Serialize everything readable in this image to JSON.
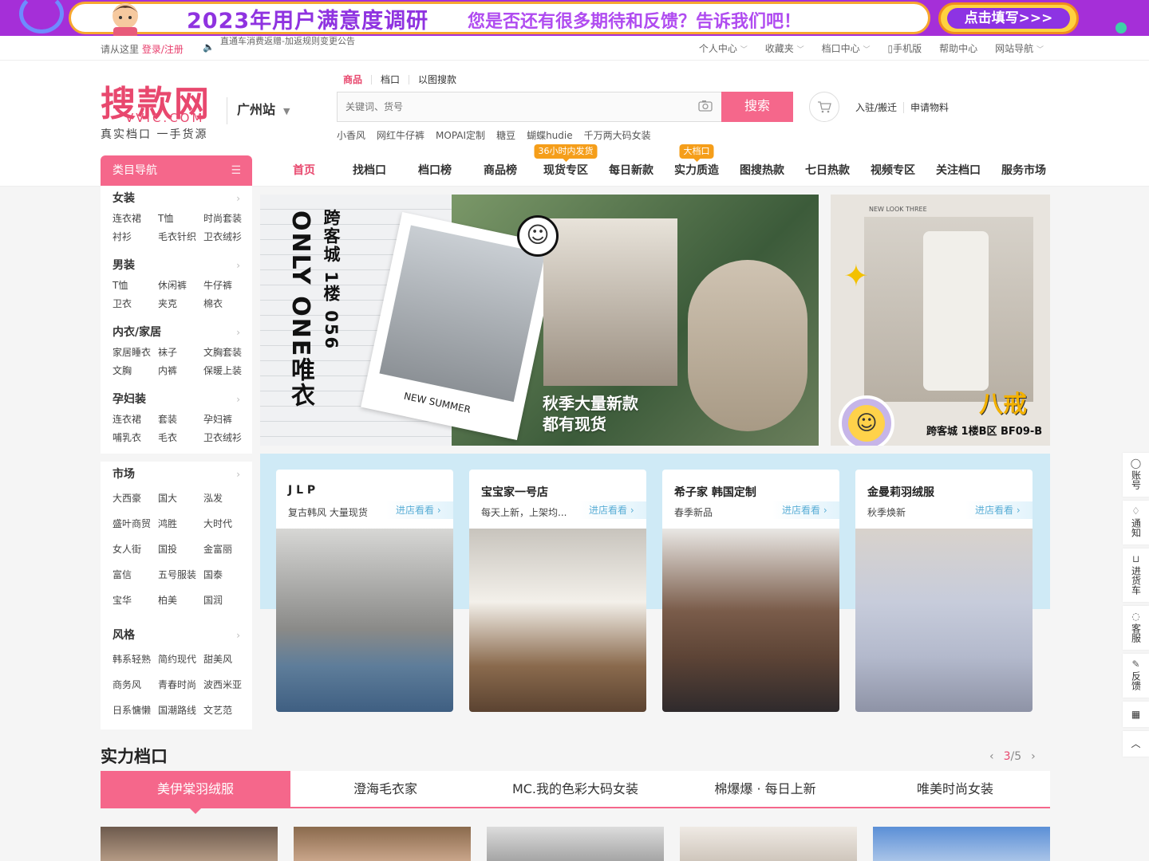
{
  "top_banner": {
    "title": "2023年用户满意度调研",
    "subtitle": "您是否还有很多期待和反馈？告诉我们吧！",
    "button": "点击填写>>>"
  },
  "top_nav": {
    "welcome": "请从这里",
    "login": "登录/注册",
    "notice": "直通车消费返赠-加返规则变更公告",
    "links": [
      "个人中心",
      "收藏夹",
      "档口中心",
      "手机版",
      "帮助中心",
      "网站导航"
    ]
  },
  "logo": {
    "cn": "搜款网",
    "en": "VVIC.COM",
    "slogan": "真实档口 一手货源"
  },
  "city": "广州站",
  "search": {
    "tabs": [
      "商品",
      "档口",
      "以图搜款"
    ],
    "placeholder": "关键词、货号",
    "button": "搜索",
    "hot_words": [
      "小香风",
      "网红牛仔裤",
      "MOPAI定制",
      "糖豆",
      "蝴蝶hudie",
      "千万两大码女装"
    ]
  },
  "header_links": [
    "入驻/搬迁",
    "申请物料"
  ],
  "category_nav_title": "类目导航",
  "main_nav": [
    {
      "label": "首页",
      "badge": ""
    },
    {
      "label": "找档口",
      "badge": ""
    },
    {
      "label": "档口榜",
      "badge": ""
    },
    {
      "label": "商品榜",
      "badge": ""
    },
    {
      "label": "现货专区",
      "badge": "36小时内发货"
    },
    {
      "label": "每日新款",
      "badge": ""
    },
    {
      "label": "实力质造",
      "badge": "大档口"
    },
    {
      "label": "图搜热款",
      "badge": ""
    },
    {
      "label": "七日热款",
      "badge": ""
    },
    {
      "label": "视频专区",
      "badge": ""
    },
    {
      "label": "关注档口",
      "badge": ""
    },
    {
      "label": "服务市场",
      "badge": ""
    }
  ],
  "sidebar": {
    "categories": [
      {
        "title": "女装",
        "items": [
          "连衣裙",
          "T恤",
          "时尚套装",
          "衬衫",
          "毛衣针织",
          "卫衣绒衫"
        ]
      },
      {
        "title": "男装",
        "items": [
          "T恤",
          "休闲裤",
          "牛仔裤",
          "卫衣",
          "夹克",
          "棉衣"
        ]
      },
      {
        "title": "内衣/家居",
        "items": [
          "家居睡衣",
          "袜子",
          "文胸套装",
          "文胸",
          "内裤",
          "保暖上装"
        ]
      },
      {
        "title": "孕妇装",
        "items": [
          "连衣裙",
          "套装",
          "孕妇裤",
          "哺乳衣",
          "毛衣",
          "卫衣绒衫"
        ]
      }
    ],
    "markets": {
      "title": "市场",
      "items": [
        "大西豪",
        "国大",
        "泓发",
        "盛叶商贸",
        "鸿胜",
        "大时代",
        "女人街",
        "国投",
        "金富丽",
        "富信",
        "五号服装",
        "国泰",
        "宝华",
        "柏美",
        "国润"
      ]
    },
    "styles": {
      "title": "风格",
      "items": [
        "韩系轻熟",
        "简约现代",
        "甜美风",
        "商务风",
        "青春时尚",
        "波西米亚",
        "日系慵懒",
        "国潮路线",
        "文艺范"
      ]
    }
  },
  "banner_main": {
    "vertical_text": "ONLY ONE唯衣",
    "location": "跨客城 1楼 056",
    "polaroid_caption": "NEW SUMMER",
    "caption_line1": "秋季大量新款",
    "caption_line2": "都有现货"
  },
  "banner_side": {
    "top_text": "NEW LOOK THREE",
    "brand": "八戒",
    "location": "跨客城 1楼B区 BF09-B"
  },
  "featured_shops": [
    {
      "name": "J L P",
      "desc": "复古韩风 大量现货",
      "go": "进店看看"
    },
    {
      "name": "宝宝家一号店",
      "desc": "每天上新，上架均...",
      "go": "进店看看"
    },
    {
      "name": "希子家 韩国定制",
      "desc": "春季新品",
      "go": "进店看看"
    },
    {
      "name": "金曼莉羽绒服",
      "desc": "秋季焕新",
      "go": "进店看看"
    }
  ],
  "strength_section": {
    "title": "实力档口",
    "page_current": "3",
    "page_total": "/5",
    "tabs": [
      "美伊棠羽绒服",
      "澄海毛衣家",
      "MC.我的色彩大码女装",
      "棉爆爆 · 每日上新",
      "唯美时尚女装"
    ]
  },
  "right_tools": [
    "账号",
    "通知",
    "进货车",
    "客服",
    "反馈"
  ],
  "colors": {
    "brand_pink": "#f5678b",
    "accent_red": "#e8486e",
    "badge_orange": "#f59e1a",
    "banner_purple": "#a52fd8"
  }
}
